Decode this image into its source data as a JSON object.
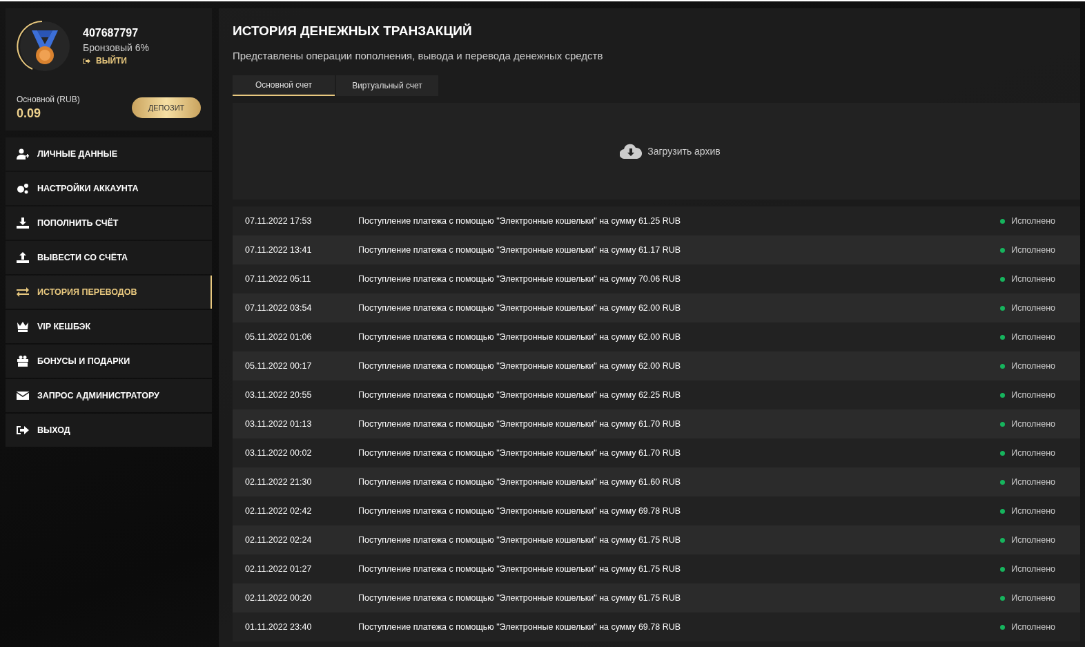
{
  "profile": {
    "user_id": "407687797",
    "level": "Бронзовый 6%",
    "logout": "ВЫЙТИ",
    "balance_label": "Основной (RUB)",
    "balance": "0.09",
    "deposit_button": "ДЕПОЗИТ"
  },
  "sidebar": {
    "items": [
      {
        "label": "ЛИЧНЫЕ ДАННЫЕ",
        "selected": false
      },
      {
        "label": "НАСТРОЙКИ АККАУНТА",
        "selected": false
      },
      {
        "label": "ПОПОЛНИТЬ СЧЁТ",
        "selected": false
      },
      {
        "label": "ВЫВЕСТИ СО СЧЁТА",
        "selected": false
      },
      {
        "label": "ИСТОРИЯ ПЕРЕВОДОВ",
        "selected": true
      },
      {
        "label": "VIP КЕШБЭК",
        "selected": false
      },
      {
        "label": "БОНУСЫ И ПОДАРКИ",
        "selected": false
      },
      {
        "label": "ЗАПРОС АДМИНИСТРАТОРУ",
        "selected": false
      },
      {
        "label": "ВЫХОД",
        "selected": false
      }
    ]
  },
  "main": {
    "title": "ИСТОРИЯ ДЕНЕЖНЫХ ТРАНЗАКЦИЙ",
    "subtitle": "Представлены операции пополнения, вывода и перевода денежных средств",
    "tabs": [
      {
        "label": "Основной счет",
        "selected": true
      },
      {
        "label": "Виртуальный счет",
        "selected": false
      }
    ],
    "archive_button": "Загрузить архив",
    "transactions": [
      {
        "date": "07.11.2022 17:53",
        "description": "Поступление платежа с помощью \"Электронные кошельки\" на сумму 61.25 RUB",
        "status": "Исполнено"
      },
      {
        "date": "07.11.2022 13:41",
        "description": "Поступление платежа с помощью \"Электронные кошельки\" на сумму 61.17 RUB",
        "status": "Исполнено"
      },
      {
        "date": "07.11.2022 05:11",
        "description": "Поступление платежа с помощью \"Электронные кошельки\" на сумму 70.06 RUB",
        "status": "Исполнено"
      },
      {
        "date": "07.11.2022 03:54",
        "description": "Поступление платежа с помощью \"Электронные кошельки\" на сумму 62.00 RUB",
        "status": "Исполнено"
      },
      {
        "date": "05.11.2022 01:06",
        "description": "Поступление платежа с помощью \"Электронные кошельки\" на сумму 62.00 RUB",
        "status": "Исполнено"
      },
      {
        "date": "05.11.2022 00:17",
        "description": "Поступление платежа с помощью \"Электронные кошельки\" на сумму 62.00 RUB",
        "status": "Исполнено"
      },
      {
        "date": "03.11.2022 20:55",
        "description": "Поступление платежа с помощью \"Электронные кошельки\" на сумму 62.25 RUB",
        "status": "Исполнено"
      },
      {
        "date": "03.11.2022 01:13",
        "description": "Поступление платежа с помощью \"Электронные кошельки\" на сумму 61.70 RUB",
        "status": "Исполнено"
      },
      {
        "date": "03.11.2022 00:02",
        "description": "Поступление платежа с помощью \"Электронные кошельки\" на сумму 61.70 RUB",
        "status": "Исполнено"
      },
      {
        "date": "02.11.2022 21:30",
        "description": "Поступление платежа с помощью \"Электронные кошельки\" на сумму 61.60 RUB",
        "status": "Исполнено"
      },
      {
        "date": "02.11.2022 02:42",
        "description": "Поступление платежа с помощью \"Электронные кошельки\" на сумму 69.78 RUB",
        "status": "Исполнено"
      },
      {
        "date": "02.11.2022 02:24",
        "description": "Поступление платежа с помощью \"Электронные кошельки\" на сумму 61.75 RUB",
        "status": "Исполнено"
      },
      {
        "date": "02.11.2022 01:27",
        "description": "Поступление платежа с помощью \"Электронные кошельки\" на сумму 61.75 RUB",
        "status": "Исполнено"
      },
      {
        "date": "02.11.2022 00:20",
        "description": "Поступление платежа с помощью \"Электронные кошельки\" на сумму 61.75 RUB",
        "status": "Исполнено"
      },
      {
        "date": "01.11.2022 23:40",
        "description": "Поступление платежа с помощью \"Электронные кошельки\" на сумму 69.78 RUB",
        "status": "Исполнено"
      }
    ]
  }
}
